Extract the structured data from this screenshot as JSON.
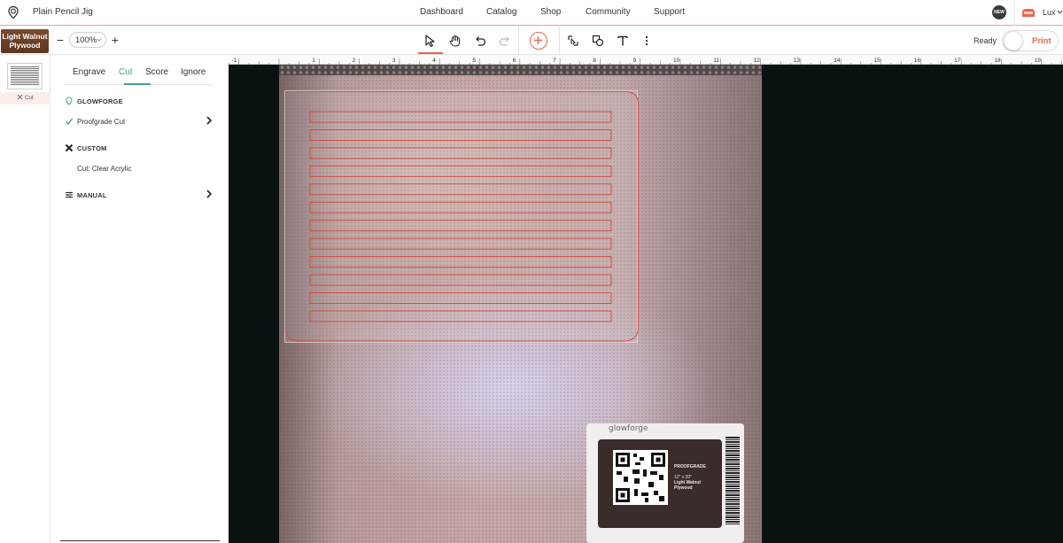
{
  "app": {
    "project_title": "Plain Pencil Jig",
    "nav": [
      "Dashboard",
      "Catalog",
      "Shop",
      "Community",
      "Support"
    ],
    "new_badge": "NEW",
    "user_name": "Lux"
  },
  "toolbar": {
    "material_name": "Light Walnut Plywood",
    "zoom_out": "−",
    "zoom_level": "100%",
    "zoom_in": "+",
    "tools": [
      "select-arrow-icon",
      "hand-pan-icon",
      "undo-icon",
      "redo-icon",
      "add-artwork-icon",
      "trace-icon",
      "shapes-icon",
      "text-icon",
      "more-options-icon"
    ],
    "status": "Ready",
    "print_label": "Print",
    "accent_color": "#e16a4f"
  },
  "thumbnails": {
    "caption": "Cut"
  },
  "settings": {
    "tabs": [
      "Engrave",
      "Cut",
      "Score",
      "Ignore"
    ],
    "active_tab": "Cut",
    "sections": {
      "glowforge_title": "GLOWFORGE",
      "glowforge_option": "Proofgrade Cut",
      "custom_title": "CUSTOM",
      "custom_option": "Cut: Clear Acrylic",
      "manual_title": "MANUAL"
    },
    "accent_color": "#4a9a9a"
  },
  "ruler": {
    "labels": [
      "-1",
      "1",
      "2",
      "3",
      "4",
      "5",
      "6",
      "7",
      "8",
      "9",
      "10",
      "11",
      "12",
      "13",
      "14",
      "15",
      "16",
      "17",
      "18",
      "19"
    ]
  },
  "design": {
    "slot_count": 12,
    "cut_color": "#d2473a"
  },
  "proofgrade_label": {
    "brand": "glowforge",
    "badge": "PROOFGRADE",
    "size": "12\" x 20\"",
    "material_line1": "Light Walnut",
    "material_line2": "Plywood"
  }
}
